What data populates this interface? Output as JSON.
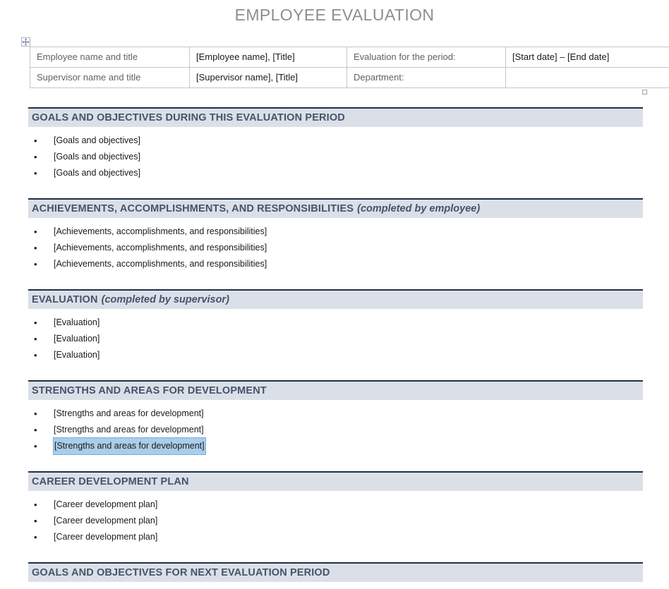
{
  "document": {
    "title": "EMPLOYEE EVALUATION",
    "title_color": "#938d87",
    "heading_bar_color": "#dbe0e8",
    "heading_text_color": "#44546a",
    "selection_highlight_color": "#a9cdeb"
  },
  "info_table": {
    "handles": {
      "move": "table-move-handle",
      "resize": "table-resize-handle"
    },
    "rows": [
      {
        "label_left": "Employee  name and title",
        "value_left": "[Employee name], [Title]",
        "label_right": "Evaluation  for the period:",
        "value_right": "[Start date] – [End date]"
      },
      {
        "label_left": "Supervisor  name and title",
        "value_left": "[Supervisor name], [Title]",
        "label_right": "Department:",
        "value_right": ""
      }
    ]
  },
  "sections": [
    {
      "heading": "GOALS AND OBJECTIVES  DURING THIS EVALUATION PERIOD",
      "heading_note": "",
      "items": [
        {
          "text": "[Goals and objectives]",
          "selected": false
        },
        {
          "text": "[Goals and objectives]",
          "selected": false
        },
        {
          "text": "[Goals and objectives]",
          "selected": false
        }
      ]
    },
    {
      "heading": "ACHIEVEMENTS,  ACCOMPLISHMENTS, AND RESPONSIBILITIES",
      "heading_note": "(completed by employee)",
      "items": [
        {
          "text": "[Achievements, accomplishments, and responsibilities]",
          "selected": false
        },
        {
          "text": "[Achievements, accomplishments, and responsibilities]",
          "selected": false
        },
        {
          "text": "[Achievements, accomplishments, and responsibilities]",
          "selected": false
        }
      ]
    },
    {
      "heading": "EVALUATION",
      "heading_note": "(completed by supervisor)",
      "items": [
        {
          "text": "[Evaluation]",
          "selected": false
        },
        {
          "text": "[Evaluation]",
          "selected": false
        },
        {
          "text": "[Evaluation]",
          "selected": false
        }
      ]
    },
    {
      "heading": "STRENGTHS  AND AREAS FOR DEVELOPMENT",
      "heading_note": "",
      "items": [
        {
          "text": "[Strengths and areas for development]",
          "selected": false
        },
        {
          "text": "[Strengths and areas for development]",
          "selected": false
        },
        {
          "text": "[Strengths and areas for development]",
          "selected": true
        }
      ]
    },
    {
      "heading": "CAREER DEVELOPMENT PLAN",
      "heading_note": "",
      "items": [
        {
          "text": "[Career development plan]",
          "selected": false
        },
        {
          "text": "[Career development plan]",
          "selected": false
        },
        {
          "text": "[Career development plan]",
          "selected": false
        }
      ]
    },
    {
      "heading": "GOALS AND OBJECTIVES  FOR NEXT EVALUATION  PERIOD",
      "heading_note": "",
      "items": []
    }
  ],
  "layout": {
    "section_tops": [
      152,
      281,
      410,
      539,
      668,
      797
    ],
    "bullets_tops": [
      188,
      317,
      446,
      575,
      704,
      833
    ]
  }
}
